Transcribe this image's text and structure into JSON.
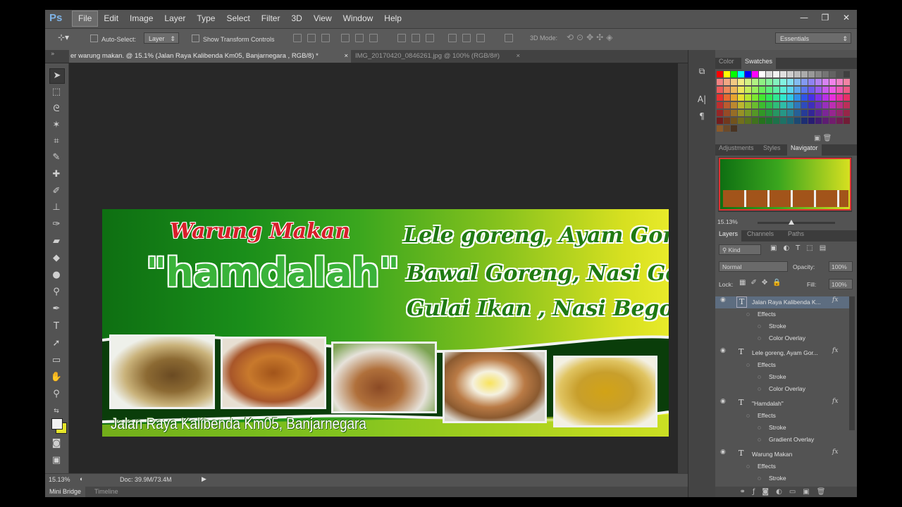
{
  "app": {
    "logo": "Ps"
  },
  "menu": [
    "File",
    "Edit",
    "Image",
    "Layer",
    "Type",
    "Select",
    "Filter",
    "3D",
    "View",
    "Window",
    "Help"
  ],
  "window_controls": {
    "minimize": "—",
    "restore": "❐",
    "close": "✕"
  },
  "options_bar": {
    "auto_select_label": "Auto-Select:",
    "auto_select_value": "Layer",
    "transform_label": "Show Transform Controls",
    "mode_3d_label": "3D Mode:",
    "workspace": "Essentials"
  },
  "doc_tabs": [
    {
      "title": "er warung makan. @ 15.1% (Jalan Raya Kalibenda Km05, Banjarnegara , RGB/8) *",
      "close": "×"
    },
    {
      "title": "IMG_20170420_0846261.jpg @ 100% (RGB/8#)",
      "close": "×"
    }
  ],
  "banner": {
    "warung": "Warung Makan",
    "hamdalah": "\"hamdalah\"",
    "menu_lines": [
      "Lele goreng, Ayam Goreng",
      "Bawal Goreng, Nasi Goreng",
      "Gulai Ikan , Nasi Begono"
    ],
    "address": "Jalan Raya Kalibenda Km05, Banjarnegara"
  },
  "status": {
    "zoom": "15.13%",
    "doc": "Doc: 39.9M/73.4M"
  },
  "bottom_tabs": [
    "Mini Bridge",
    "Timeline"
  ],
  "panels": {
    "color_tabs": [
      "Color",
      "Swatches"
    ],
    "adj_tabs": [
      "Adjustments",
      "Styles",
      "Navigator"
    ],
    "nav_zoom": "15.13%",
    "layer_tabs": [
      "Layers",
      "Channels",
      "Paths"
    ],
    "kind": "Kind",
    "blend_mode": "Normal",
    "opacity_label": "Opacity:",
    "opacity_value": "100%",
    "lock_label": "Lock:",
    "fill_label": "Fill:",
    "fill_value": "100%"
  },
  "layers": [
    {
      "name": "Jalan Raya Kalibenda K...",
      "effects": "Effects",
      "fx1": "Stroke",
      "fx2": "Color Overlay",
      "selected": true
    },
    {
      "name": "Lele goreng, Ayam Gor...",
      "effects": "Effects",
      "fx1": "Stroke",
      "fx2": "Color Overlay",
      "selected": false
    },
    {
      "name": "\"Hamdalah\"",
      "effects": "Effects",
      "fx1": "Stroke",
      "fx2": "Gradient Overlay",
      "selected": false
    },
    {
      "name": "Warung Makan",
      "effects": "Effects",
      "fx1": "Stroke",
      "selected": false
    }
  ],
  "colors": {
    "accent_green": "#1a8e1a",
    "menu_text_green": "#1f7a12",
    "hamdalah_green": "#3ab33a",
    "warung_red": "#d81e2a",
    "selected_layer": "#5d6d80"
  }
}
